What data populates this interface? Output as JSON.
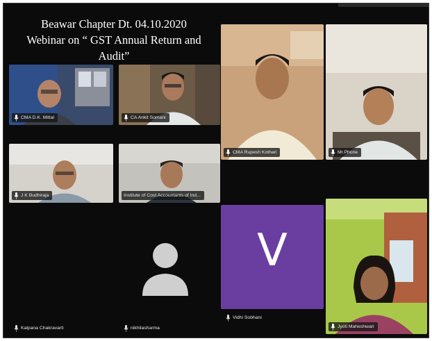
{
  "meeting": {
    "title_line1": "Beawar Chapter Dt. 04.10.2020",
    "title_line2": "Webinar on “ GST Annual Return and Audit”"
  },
  "participants": [
    {
      "name": "CMA D.K. Mittal",
      "video": "on"
    },
    {
      "name": "CA Ankit Somani",
      "video": "on"
    },
    {
      "name": "CMA Rupesh Kothari",
      "video": "on"
    },
    {
      "name": "Mr.Phone",
      "video": "on"
    },
    {
      "name": "J K Budhiraja",
      "video": "on"
    },
    {
      "name": "Institute of Cost Accountants of Ind...",
      "video": "on"
    },
    {
      "name": "Kalpana Chakravarti",
      "video": "off"
    },
    {
      "name": "nikhilasharma",
      "video": "off"
    },
    {
      "name": "Vidhi Sobhani",
      "video": "off",
      "avatar_letter": "V"
    },
    {
      "name": "Jyoti Maheshwari",
      "video": "on"
    }
  ],
  "icons": {
    "mic": "microphone-icon",
    "default_avatar": "person-silhouette-icon"
  },
  "colors": {
    "background": "#0b0b0b",
    "avatar_tile": "#6a3ea1",
    "name_text": "#e8e8e8"
  }
}
